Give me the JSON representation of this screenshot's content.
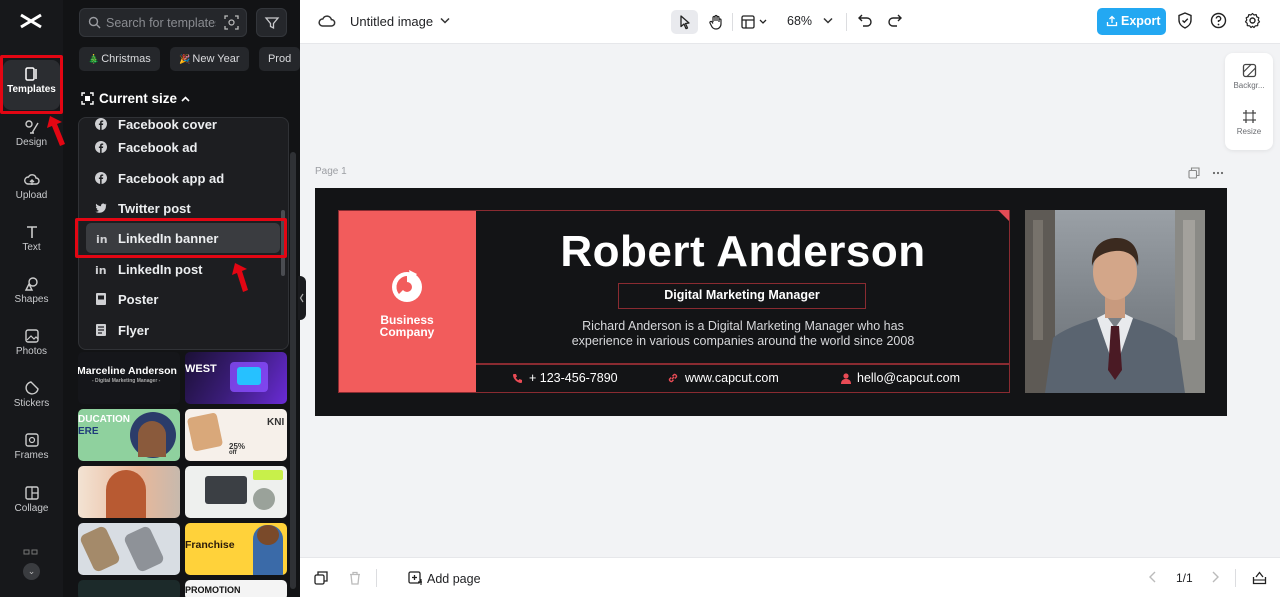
{
  "sidebar": {
    "items": [
      {
        "label": "Templates",
        "icon": "templates-icon",
        "active": true
      },
      {
        "label": "Design",
        "icon": "design-icon"
      },
      {
        "label": "Upload",
        "icon": "upload-icon"
      },
      {
        "label": "Text",
        "icon": "text-icon"
      },
      {
        "label": "Shapes",
        "icon": "shapes-icon"
      },
      {
        "label": "Photos",
        "icon": "photos-icon"
      },
      {
        "label": "Stickers",
        "icon": "stickers-icon"
      },
      {
        "label": "Frames",
        "icon": "frames-icon"
      },
      {
        "label": "Collage",
        "icon": "collage-icon"
      }
    ]
  },
  "panel": {
    "search_placeholder": "Search for templates",
    "chips": [
      {
        "label": "Christmas",
        "emoji": "🎄"
      },
      {
        "label": "New Year",
        "emoji": "🎉"
      },
      {
        "label": "Prod"
      }
    ],
    "current_size_label": "Current size",
    "size_options": [
      {
        "label": "Facebook cover",
        "icon": "facebook-icon"
      },
      {
        "label": "Facebook ad",
        "icon": "facebook-icon"
      },
      {
        "label": "Facebook app ad",
        "icon": "facebook-icon"
      },
      {
        "label": "Twitter post",
        "icon": "twitter-icon"
      },
      {
        "label": "LinkedIn banner",
        "icon": "linkedin-icon",
        "selected": true
      },
      {
        "label": "LinkedIn post",
        "icon": "linkedin-icon"
      },
      {
        "label": "Poster",
        "icon": "poster-icon"
      },
      {
        "label": "Flyer",
        "icon": "flyer-icon"
      }
    ],
    "thumb_texts": {
      "t1": "Marceline Anderson",
      "t1b": "- Digital Marketing Manager -",
      "t2": "WEST",
      "t3": "DUCATION",
      "t3b": "ERE",
      "t4": "KNI",
      "t4b": "25%",
      "t4c": "off",
      "t7": "Franchise",
      "t8": "PROMOTION"
    }
  },
  "topbar": {
    "title": "Untitled image",
    "zoom": "68%",
    "export_label": "Export"
  },
  "right_panel": {
    "background_label": "Backgr...",
    "resize_label": "Resize"
  },
  "canvas": {
    "page_label": "Page 1",
    "banner": {
      "company": [
        "Business",
        "Company"
      ],
      "name": "Robert Anderson",
      "role": "Digital Marketing Manager",
      "description": [
        "Richard Anderson is a Digital Marketing Manager who has",
        "experience in various companies around the world since 2008"
      ],
      "phone": "+ 123-456-7890",
      "website": "www.capcut.com",
      "email": "hello@capcut.com"
    }
  },
  "bottombar": {
    "add_page_label": "Add page",
    "pager": "1/1"
  },
  "colors": {
    "accent": "#23a8f2",
    "banner_red": "#f25c5c",
    "highlight": "#e30613"
  }
}
